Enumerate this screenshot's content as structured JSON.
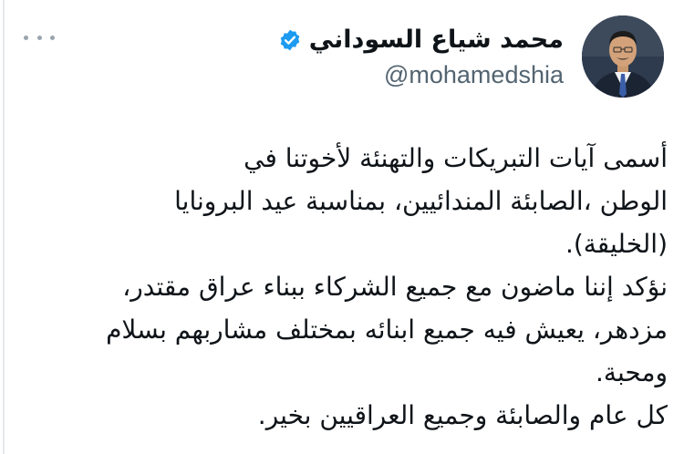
{
  "author": {
    "display_name": "محمد شياع السوداني",
    "handle": "@mohamedshia",
    "verified_icon": "verified-badge-icon",
    "avatar_icon": "profile-photo-avatar"
  },
  "more_menu_icon": "more-horizontal-icon",
  "tweet": {
    "lines": [
      "أسمى آيات التبريكات والتهنئة لأخوتنا في",
      "الوطن ،الصابئة المندائيين، بمناسبة عيد  البرونايا",
      "(الخليقة).",
      "نؤكد إننا ماضون مع جميع الشركاء ببناء عراق مقتدر،",
      "مزدهر، يعيش فيه جميع ابنائه بمختلف مشاربهم بسلام",
      "ومحبة.",
      "كل عام والصابئة وجميع العراقيين بخير."
    ]
  },
  "colors": {
    "text_primary": "#0f1419",
    "text_secondary": "#536471",
    "verified_blue": "#1d9bf0",
    "border": "#e6e8eb"
  }
}
